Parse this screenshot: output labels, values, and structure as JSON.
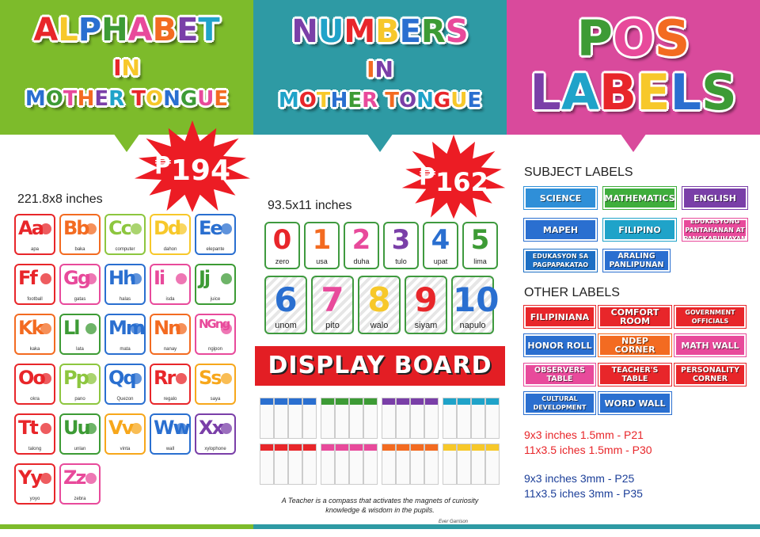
{
  "alphabet_panel": {
    "title": [
      "ALPHABET",
      "IN",
      "MOTHER TONGUE"
    ],
    "header_color": "#7dbb2b",
    "price_symbol": "₱",
    "price": "194",
    "size": "221.8x8 inches",
    "cards": [
      {
        "letters": "Aa",
        "word": "apa",
        "color": "#e8262a"
      },
      {
        "letters": "Bb",
        "word": "baka",
        "color": "#f36b21"
      },
      {
        "letters": "Cc",
        "word": "computer",
        "color": "#8dc63f"
      },
      {
        "letters": "Dd",
        "word": "dahon",
        "color": "#f7c82a"
      },
      {
        "letters": "Ee",
        "word": "elepante",
        "color": "#2a6fd0"
      },
      {
        "letters": "Ff",
        "word": "football",
        "color": "#e8262a"
      },
      {
        "letters": "Gg",
        "word": "gatas",
        "color": "#e84a9b"
      },
      {
        "letters": "Hh",
        "word": "halas",
        "color": "#2a6fd0"
      },
      {
        "letters": "Ii",
        "word": "isda",
        "color": "#e84a9b"
      },
      {
        "letters": "Jj",
        "word": "juice",
        "color": "#3d9b35"
      },
      {
        "letters": "Kk",
        "word": "kaka",
        "color": "#f36b21"
      },
      {
        "letters": "Ll",
        "word": "lata",
        "color": "#3d9b35"
      },
      {
        "letters": "Mm",
        "word": "mata",
        "color": "#2a6fd0"
      },
      {
        "letters": "Nn",
        "word": "nanay",
        "color": "#f36b21"
      },
      {
        "letters": "NGng",
        "word": "ngipon",
        "color": "#e84a9b"
      },
      {
        "letters": "Oo",
        "word": "okra",
        "color": "#e8262a"
      },
      {
        "letters": "Pp",
        "word": "pano",
        "color": "#8dc63f"
      },
      {
        "letters": "Qq",
        "word": "Quezon",
        "color": "#2a6fd0"
      },
      {
        "letters": "Rr",
        "word": "regalo",
        "color": "#e8262a"
      },
      {
        "letters": "Ss",
        "word": "saya",
        "color": "#f7a71b"
      },
      {
        "letters": "Tt",
        "word": "talong",
        "color": "#e8262a"
      },
      {
        "letters": "Uu",
        "word": "unlan",
        "color": "#3d9b35"
      },
      {
        "letters": "Vv",
        "word": "vinta",
        "color": "#f7a71b"
      },
      {
        "letters": "Ww",
        "word": "wall",
        "color": "#2a6fd0"
      },
      {
        "letters": "Xx",
        "word": "xylophone",
        "color": "#7a3fa8"
      },
      {
        "letters": "Yy",
        "word": "yoyo",
        "color": "#e8262a"
      },
      {
        "letters": "Zz",
        "word": "zebra",
        "color": "#e84a9b"
      }
    ]
  },
  "numbers_panel": {
    "title": [
      "NUMBERS",
      "IN",
      "MOTHER TONGUE"
    ],
    "header_color": "#2e9aa4",
    "price_symbol": "₱",
    "price": "162",
    "size": "93.5x11 inches",
    "cards": [
      {
        "num": "0",
        "word": "zero",
        "color": "#e8262a"
      },
      {
        "num": "1",
        "word": "usa",
        "color": "#f36b21"
      },
      {
        "num": "2",
        "word": "duha",
        "color": "#e84a9b"
      },
      {
        "num": "3",
        "word": "tulo",
        "color": "#7a3fa8"
      },
      {
        "num": "4",
        "word": "upat",
        "color": "#2a6fd0"
      },
      {
        "num": "5",
        "word": "lima",
        "color": "#3d9b35"
      },
      {
        "num": "6",
        "word": "unom",
        "color": "#2a6fd0"
      },
      {
        "num": "7",
        "word": "pito",
        "color": "#e84a9b"
      },
      {
        "num": "8",
        "word": "walo",
        "color": "#f7c82a"
      },
      {
        "num": "9",
        "word": "siyam",
        "color": "#e8262a"
      },
      {
        "num": "10",
        "word": "napulo",
        "color": "#2a6fd0"
      }
    ],
    "display_board": "DISPLAY BOARD",
    "quote": "A Teacher is a compass that activates the magnets of curiosity knowledge & wisdom in the pupils.",
    "quote_author": "Ever Garrison"
  },
  "pos_panel": {
    "title": [
      "POS",
      "LABELS"
    ],
    "header_color": "#d94a9c",
    "subject_heading": "SUBJECT LABELS",
    "subject_labels": [
      {
        "text": "SCIENCE",
        "bg": "#2f8fd8"
      },
      {
        "text": "MATHEMATICS",
        "bg": "#3fae3c"
      },
      {
        "text": "ENGLISH",
        "bg": "#7a3fa8"
      },
      {
        "text": "MAPEH",
        "bg": "#2a6fd0"
      },
      {
        "text": "FILIPINO",
        "bg": "#1fa3c9"
      },
      {
        "text": "EDUKASYONG PANTAHANAN AT PANGKABUHAYAN",
        "bg": "#e84a9b"
      },
      {
        "text": "EDUKASYON SA PAGPAPAKATAO",
        "bg": "#1c6fc4"
      },
      {
        "text": "ARALING PANLIPUNAN",
        "bg": "#2a6fd0"
      }
    ],
    "other_heading": "OTHER LABELS",
    "other_labels": [
      {
        "text": "FILIPINIANA",
        "bg": "#e8262a"
      },
      {
        "text": "COMFORT ROOM",
        "bg": "#e8262a"
      },
      {
        "text": "GOVERNMENT OFFICIALS",
        "bg": "#e8262a"
      },
      {
        "text": "HONOR ROLL",
        "bg": "#2a6fd0"
      },
      {
        "text": "NDEP CORNER",
        "bg": "#f36b21"
      },
      {
        "text": "MATH WALL",
        "bg": "#e84a9b"
      },
      {
        "text": "OBSERVERS TABLE",
        "bg": "#e84a9b"
      },
      {
        "text": "TEACHER'S TABLE",
        "bg": "#e8262a"
      },
      {
        "text": "PERSONALITY CORNER",
        "bg": "#e8262a"
      },
      {
        "text": "VALUES & CULTURAL DEVELOPMENT CORNER",
        "bg": "#2a6fd0"
      },
      {
        "text": "WORD WALL",
        "bg": "#2a6fd0"
      }
    ],
    "prices_red": [
      "9x3 inches 1.5mm - P21",
      "11x3.5 iches 1.5mm - P30"
    ],
    "prices_blue": [
      "9x3 inches 3mm - P25",
      "11x3.5 iches 3mm - P35"
    ],
    "red_color": "#e8262a",
    "blue_color": "#1c3f99"
  },
  "letter_palette": [
    "#e8262a",
    "#f7c82a",
    "#2a6fd0",
    "#3d9b35",
    "#e84a9b",
    "#f36b21",
    "#7a3fa8",
    "#1fa3c9"
  ]
}
